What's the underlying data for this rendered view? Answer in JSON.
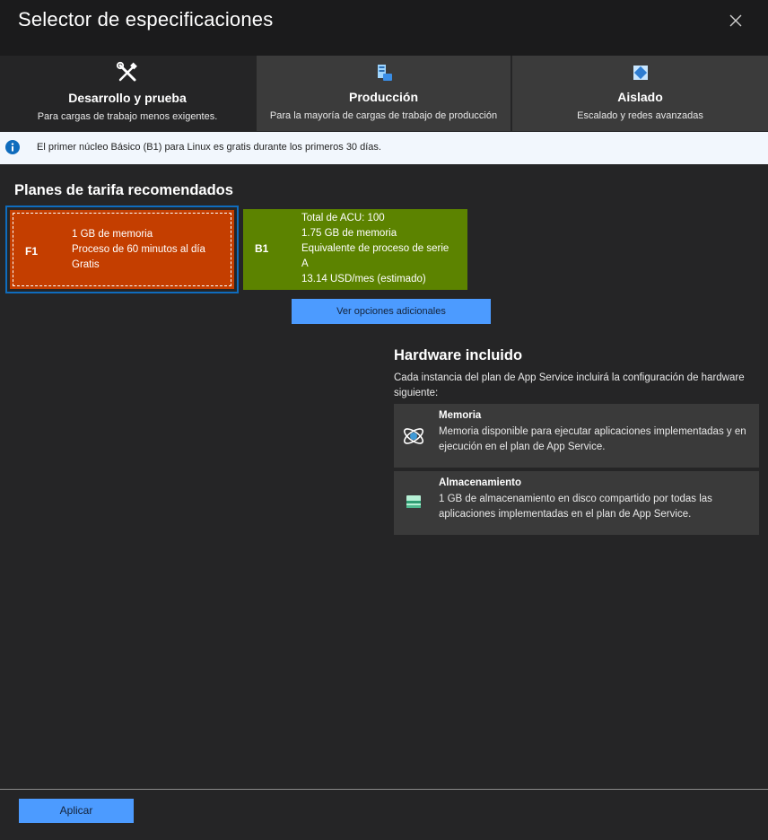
{
  "dialog": {
    "title": "Selector de especificaciones",
    "close_icon": "close-icon"
  },
  "tabs": [
    {
      "name": "Desarrollo y prueba",
      "description": "Para cargas de trabajo menos exigentes.",
      "icon": "tools-icon",
      "selected": true
    },
    {
      "name": "Producción",
      "description": "Para la mayoría de cargas de trabajo de producción",
      "icon": "production-icon",
      "selected": false
    },
    {
      "name": "Aislado",
      "description": "Escalado y redes avanzadas",
      "icon": "isolated-icon",
      "selected": false
    }
  ],
  "info_banner": {
    "text": "El primer núcleo Básico (B1) para Linux es gratis durante los primeros 30 días.",
    "icon": "info-icon"
  },
  "recommended": {
    "title": "Planes de tarifa recomendados",
    "tiers": [
      {
        "code": "F1",
        "lines": [
          "1 GB de memoria",
          "Proceso de 60 minutos al día",
          "Gratis"
        ],
        "color": "#c43e00",
        "selected": true
      },
      {
        "code": "B1",
        "lines": [
          "Total de ACU: 100",
          "1.75 GB de memoria",
          "Equivalente de proceso de serie",
          "A",
          "13.14 USD/mes (estimado)"
        ],
        "color": "#5c8300",
        "selected": false
      }
    ],
    "more_options_label": "Ver opciones adicionales"
  },
  "hardware": {
    "title": "Hardware incluido",
    "description": "Cada instancia del plan de App Service incluirá la configuración de hardware siguiente:",
    "items": [
      {
        "name": "Memoria",
        "description": "Memoria disponible para ejecutar aplicaciones implementadas y en ejecución en el plan de App Service.",
        "icon": "memory-icon"
      },
      {
        "name": "Almacenamiento",
        "description": "1 GB de almacenamiento en disco compartido por todas las aplicaciones implementadas en el plan de App Service.",
        "icon": "storage-icon"
      }
    ]
  },
  "footer": {
    "apply_label": "Aplicar"
  },
  "colors": {
    "accent": "#4c9bff",
    "selection_border": "#0f6cbd",
    "background": "#252526"
  }
}
